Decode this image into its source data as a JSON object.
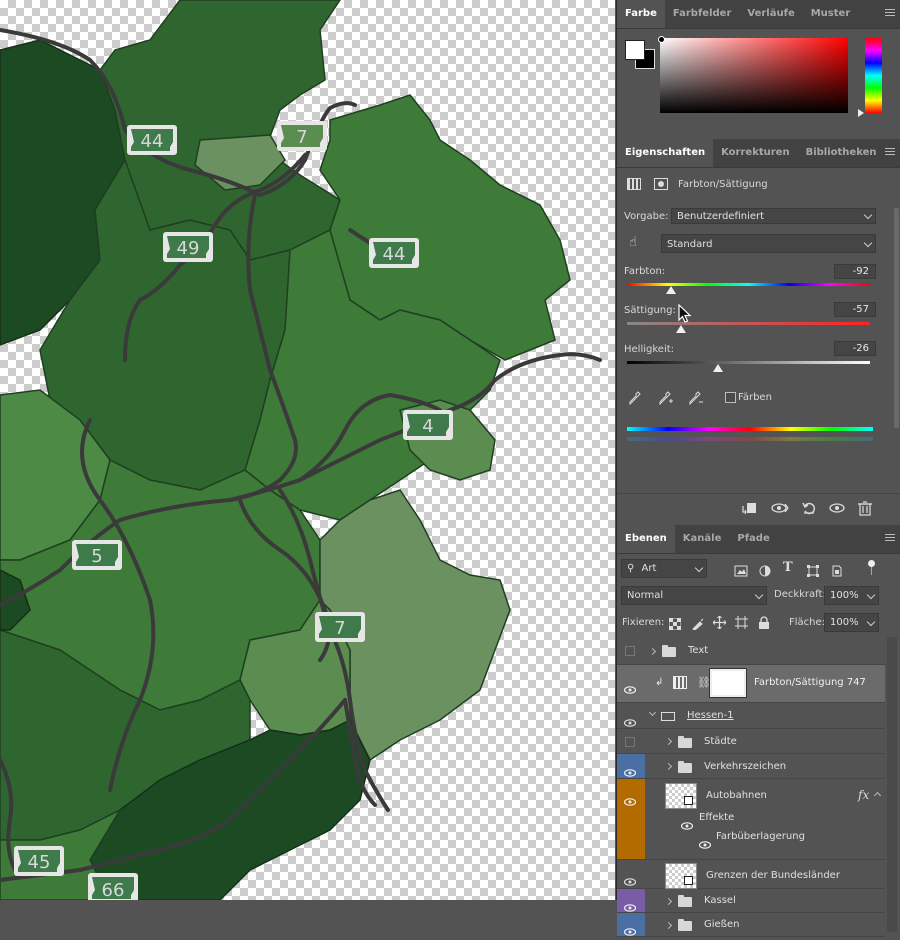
{
  "map": {
    "road_signs": [
      {
        "number": "44",
        "kind": "autobahn"
      },
      {
        "number": "7",
        "kind": "autobahn-light"
      },
      {
        "number": "49",
        "kind": "autobahn"
      },
      {
        "number": "44",
        "kind": "autobahn"
      },
      {
        "number": "4",
        "kind": "autobahn"
      },
      {
        "number": "5",
        "kind": "autobahn"
      },
      {
        "number": "7",
        "kind": "autobahn"
      },
      {
        "number": "45",
        "kind": "autobahn"
      },
      {
        "number": "66",
        "kind": "autobahn"
      }
    ],
    "colors": {
      "dark": "#1c4a22",
      "mid": "#2f6630",
      "medium": "#3e7a38",
      "light": "#5b8c50",
      "pale": "#6b9160",
      "road": "#3a3a3a",
      "sign_fill": "#3e7a4a",
      "sign_border": "#e6e6e6"
    }
  },
  "color_panel": {
    "tabs": [
      "Farbe",
      "Farbfelder",
      "Verläufe",
      "Muster"
    ],
    "foreground": "#ffffff",
    "background": "#000000",
    "picker_hue": "#ff0000"
  },
  "properties_panel": {
    "tabs": [
      "Eigenschaften",
      "Korrekturen",
      "Bibliotheken"
    ],
    "adjustment_title": "Farbton/Sättigung",
    "preset_label": "Vorgabe:",
    "preset_value": "Benutzerdefiniert",
    "channel_value": "Standard",
    "hue_label": "Farbton:",
    "hue_value": "-92",
    "hue_level": -92,
    "saturation_label": "Sättigung:",
    "saturation_value": "-57",
    "saturation_level": -57,
    "lightness_label": "Helligkeit:",
    "lightness_value": "-26",
    "lightness_level": -26,
    "colorize_label": "Färben",
    "colorize_checked": false
  },
  "layers_panel": {
    "tabs": [
      "Ebenen",
      "Kanäle",
      "Pfade"
    ],
    "filter_kind": "Art",
    "blend_mode": "Normal",
    "opacity_label": "Deckkraft:",
    "opacity_value": "100%",
    "lock_label": "Fixieren:",
    "fill_label": "Fläche:",
    "fill_value": "100%",
    "layers": {
      "text": "Text",
      "adjustment": "Farbton/Sättigung 747",
      "group_hessen": "Hessen-1",
      "staedte": "Städte",
      "verkehrszeichen": "Verkehrszeichen",
      "autobahnen": "Autobahnen",
      "fx": "fx",
      "effekte": "Effekte",
      "farbueberlagerung": "Farbüberlagerung",
      "grenzen": "Grenzen der Bundesländer",
      "kassel": "Kassel",
      "giessen": "Gießen"
    },
    "tag_colors": {
      "blue": "#4a6fa5",
      "orange": "#b36b00",
      "violet": "#7a5ba5"
    }
  }
}
